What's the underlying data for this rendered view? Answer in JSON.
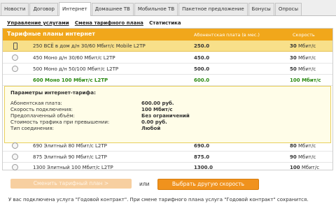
{
  "tabs": [
    "Новости",
    "Договор",
    "Интернет",
    "Домашнее ТВ",
    "Мобильное ТВ",
    "Пакетное предложение",
    "Бонусы",
    "Опросы"
  ],
  "active_tab": "Интернет",
  "subnav": {
    "manage": "Управление услугами",
    "change": "Смена тарифного плана",
    "stats": "Статистика"
  },
  "table": {
    "headers": {
      "plans": "Тарифные планы интернет",
      "fee": "Абонентская плата (в мес.)",
      "speed": "Скорость"
    },
    "rows": [
      {
        "name": "250 ВСЁ в дом д/н 30/60 Мбит/с Mobile L2TP",
        "price": "250.0",
        "speed_num": "30",
        "speed_unit": "Мбит/с",
        "state": "selected"
      },
      {
        "name": "450 Моно д/н 30/60 Мбит/с L2TP",
        "price": "450.0",
        "speed_num": "30",
        "speed_unit": "Мбит/с",
        "state": "normal"
      },
      {
        "name": "500 Моно д/н 50/100 Мбит/с L2TP",
        "price": "500.0",
        "speed_num": "50",
        "speed_unit": "Мбит/с",
        "state": "normal"
      },
      {
        "name": "600 Моно 100 Мбит/с L2TP",
        "price": "600.0",
        "speed_num": "100",
        "speed_unit": "Мбит/с",
        "state": "current"
      }
    ],
    "rows_after": [
      {
        "name": "690 Элитный 80 Мбит/с L2TP",
        "price": "690.0",
        "speed_num": "80",
        "speed_unit": "Мбит/с"
      },
      {
        "name": "875 Элитный 90 Мбит/с L2TP",
        "price": "875.0",
        "speed_num": "90",
        "speed_unit": "Мбит/с"
      },
      {
        "name": "1300 Элитный 100 Мбит/с L2TP",
        "price": "1300.0",
        "speed_num": "100",
        "speed_unit": "Мбит/с"
      }
    ]
  },
  "params": {
    "title": "Параметры интернет-тарифа:",
    "items": [
      {
        "label": "Абонентская плата:",
        "value": "600.00 руб."
      },
      {
        "label": "Скорость подключения:",
        "value": "100 Мбит/с"
      },
      {
        "label": "Предоплаченный объём:",
        "value": "Без ограничений"
      },
      {
        "label": "Стоимость трафика при превышении:",
        "value": "0.00 руб."
      },
      {
        "label": "Тип соединения:",
        "value": "Любой"
      }
    ]
  },
  "buttons": {
    "change": "Сменить тарифный план >",
    "or": "или",
    "other_speed": "Выбрать другую скорость"
  },
  "footer": "У вас подключена услуга \"Годовой контракт\". При смене тарифного плана услуга \"Годовой контракт\" сохранится.",
  "colors": {
    "accent": "#f1a71b",
    "selected_row": "#f8e08a",
    "current_green": "#2b8a14",
    "button_orange": "#f0921d"
  }
}
